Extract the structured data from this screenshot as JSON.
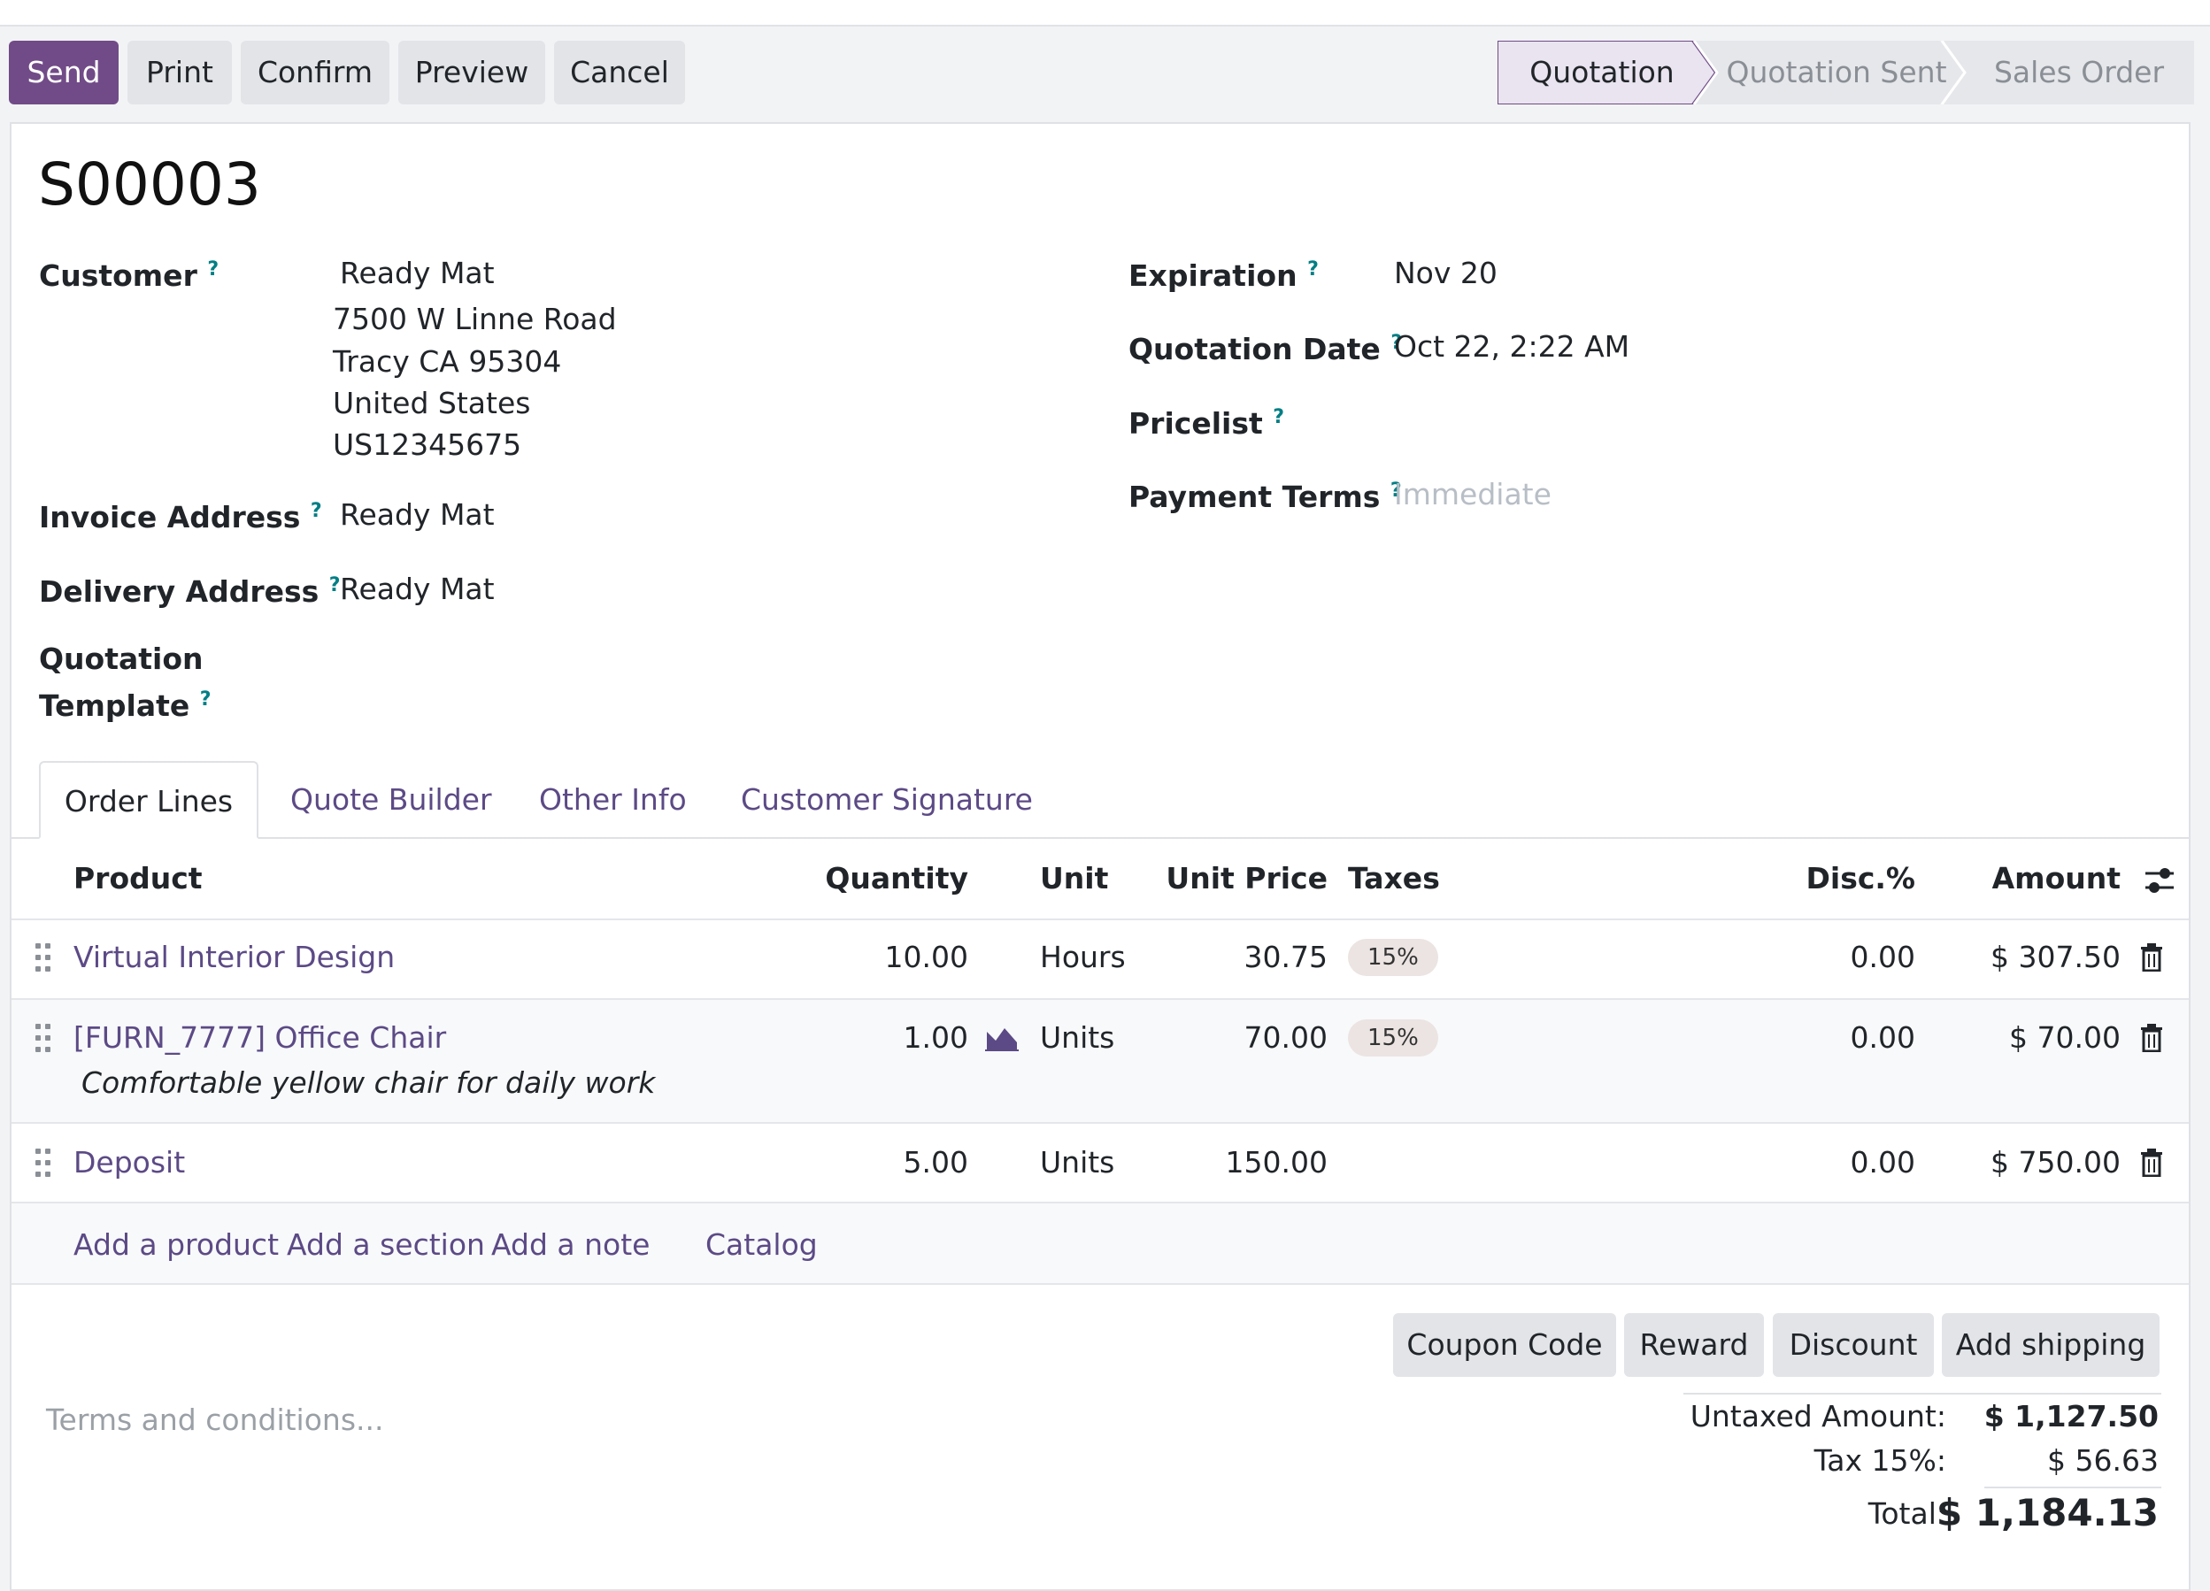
{
  "actions": {
    "send": "Send",
    "print": "Print",
    "confirm": "Confirm",
    "preview": "Preview",
    "cancel": "Cancel"
  },
  "status": {
    "stages": [
      "Quotation",
      "Quotation Sent",
      "Sales Order"
    ],
    "active": "Quotation"
  },
  "record": {
    "name": "S00003"
  },
  "fields": {
    "customer_label": "Customer",
    "customer_name": "Ready Mat",
    "customer_address": [
      "7500 W Linne Road",
      "Tracy CA 95304",
      "United States",
      "US12345675"
    ],
    "invoice_label": "Invoice Address",
    "invoice_value": "Ready Mat",
    "delivery_label": "Delivery Address",
    "delivery_value": "Ready Mat",
    "template_label_1": "Quotation",
    "template_label_2": "Template",
    "expiration_label": "Expiration",
    "expiration_value": "Nov 20",
    "quotation_date_label": "Quotation Date",
    "quotation_date_value": "Oct 22, 2:22 AM",
    "pricelist_label": "Pricelist",
    "payment_terms_label": "Payment Terms",
    "payment_terms_placeholder": "Immediate",
    "help_mark": "?"
  },
  "tabs": [
    "Order Lines",
    "Quote Builder",
    "Other Info",
    "Customer Signature"
  ],
  "table": {
    "headers": {
      "product": "Product",
      "quantity": "Quantity",
      "unit": "Unit",
      "unit_price": "Unit Price",
      "taxes": "Taxes",
      "discount": "Disc.%",
      "amount": "Amount"
    },
    "rows": [
      {
        "product": "Virtual Interior Design",
        "description": "",
        "quantity": "10.00",
        "unit": "Hours",
        "unit_price": "30.75",
        "tax": "15%",
        "discount": "0.00",
        "amount": "$ 307.50"
      },
      {
        "product": "[FURN_7777] Office Chair",
        "description": "Comfortable yellow chair for daily work",
        "quantity": "1.00",
        "unit": "Units",
        "unit_price": "70.00",
        "tax": "15%",
        "discount": "0.00",
        "amount": "$ 70.00"
      },
      {
        "product": "Deposit",
        "description": "",
        "quantity": "5.00",
        "unit": "Units",
        "unit_price": "150.00",
        "tax": "",
        "discount": "0.00",
        "amount": "$ 750.00"
      }
    ],
    "add_links": {
      "product": "Add a product",
      "section": "Add a section",
      "note": "Add a note",
      "catalog": "Catalog"
    }
  },
  "summary_buttons": [
    "Coupon Code",
    "Reward",
    "Discount",
    "Add shipping"
  ],
  "terms_placeholder": "Terms and conditions...",
  "totals": {
    "untaxed_label": "Untaxed Amount:",
    "untaxed_value": "$ 1,127.50",
    "tax_label": "Tax 15%:",
    "tax_value": "$ 56.63",
    "total_label": "Total:",
    "total_value": "$ 1,184.13"
  },
  "colors": {
    "primary": "#714b87",
    "link": "#5c4a86",
    "help": "#017e84"
  }
}
